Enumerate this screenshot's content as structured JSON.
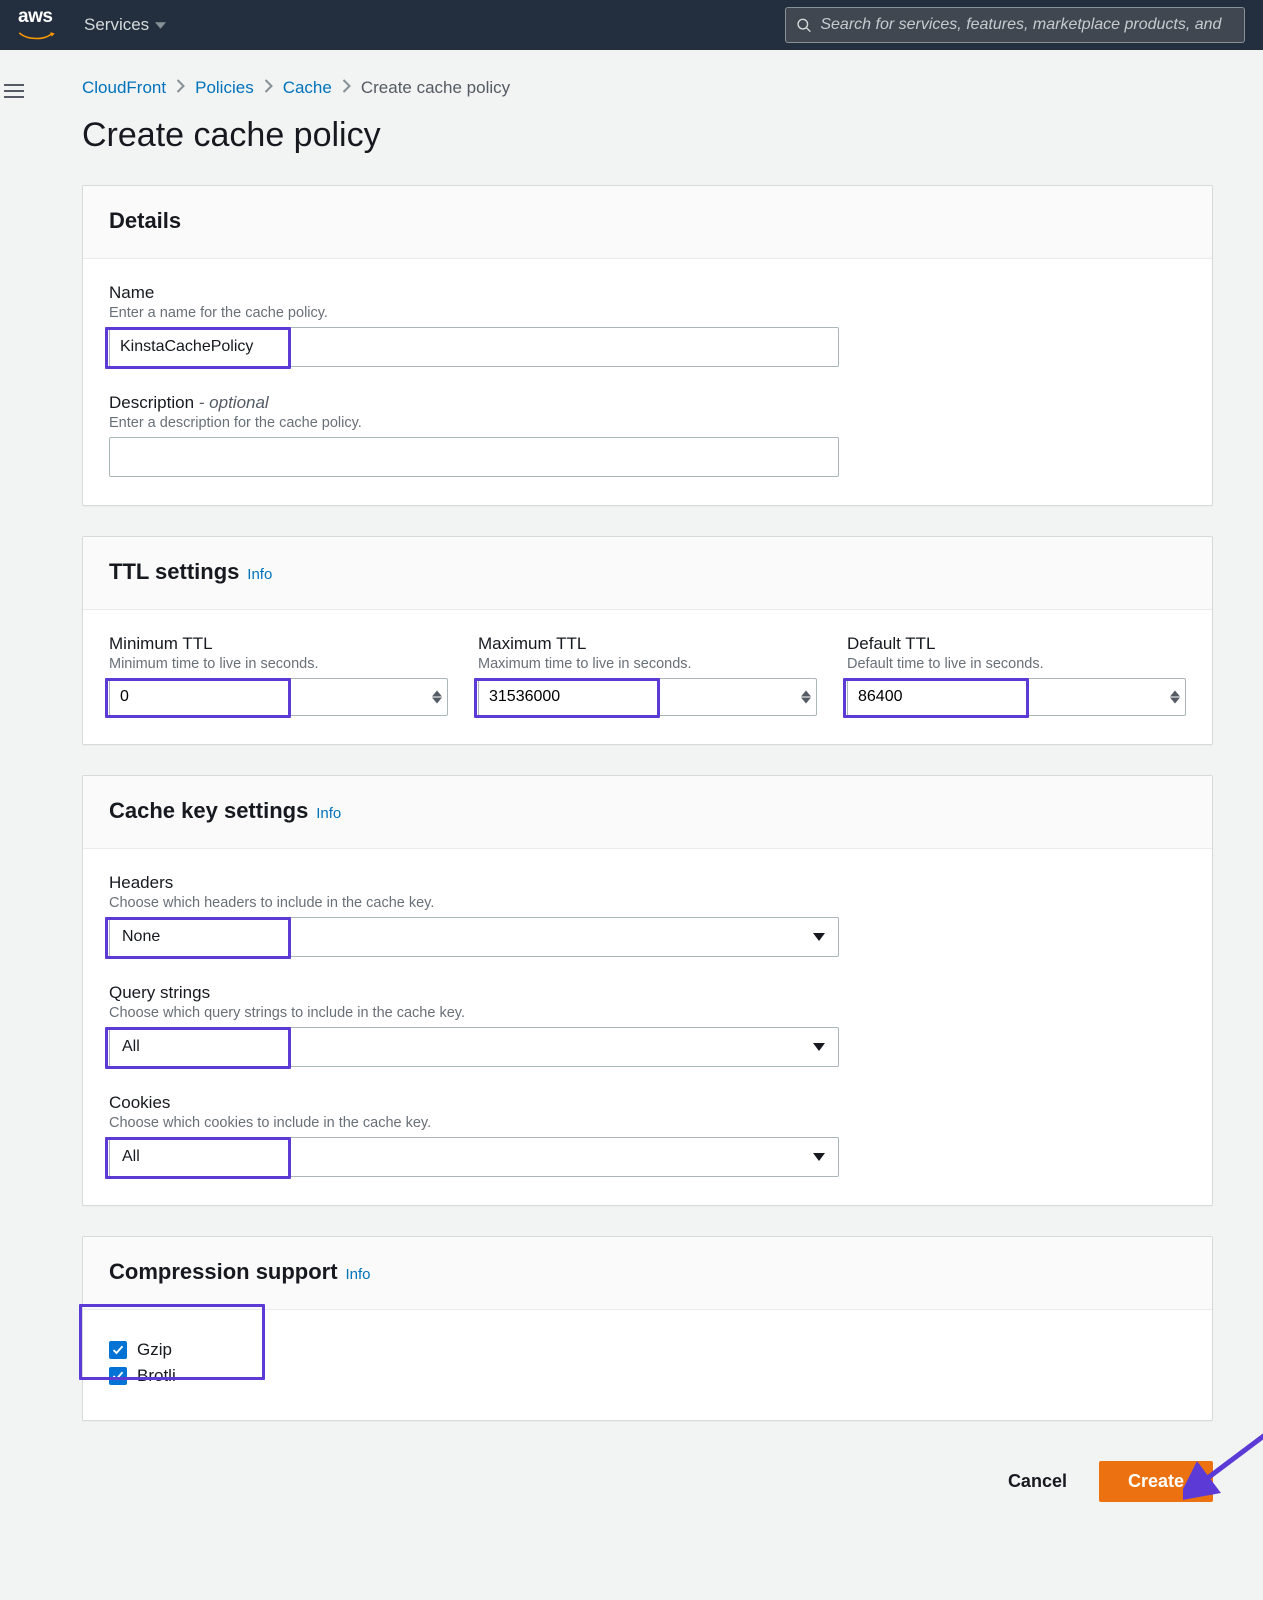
{
  "nav": {
    "brand": "aws",
    "services_label": "Services",
    "search_placeholder": "Search for services, features, marketplace products, and"
  },
  "breadcrumb": {
    "items": [
      "CloudFront",
      "Policies",
      "Cache",
      "Create cache policy"
    ]
  },
  "page": {
    "title": "Create cache policy"
  },
  "details": {
    "heading": "Details",
    "name_label": "Name",
    "name_hint": "Enter a name for the cache policy.",
    "name_value": "KinstaCachePolicy",
    "desc_label": "Description",
    "desc_optional": " - optional",
    "desc_hint": "Enter a description for the cache policy.",
    "desc_value": ""
  },
  "ttl": {
    "heading": "TTL settings",
    "info": "Info",
    "min_label": "Minimum TTL",
    "min_hint": "Minimum time to live in seconds.",
    "min_value": "0",
    "max_label": "Maximum TTL",
    "max_hint": "Maximum time to live in seconds.",
    "max_value": "31536000",
    "def_label": "Default TTL",
    "def_hint": "Default time to live in seconds.",
    "def_value": "86400"
  },
  "cachekey": {
    "heading": "Cache key settings",
    "info": "Info",
    "headers_label": "Headers",
    "headers_hint": "Choose which headers to include in the cache key.",
    "headers_value": "None",
    "qs_label": "Query strings",
    "qs_hint": "Choose which query strings to include in the cache key.",
    "qs_value": "All",
    "cookies_label": "Cookies",
    "cookies_hint": "Choose which cookies to include in the cache key.",
    "cookies_value": "All"
  },
  "compression": {
    "heading": "Compression support",
    "info": "Info",
    "gzip_label": "Gzip",
    "gzip_checked": true,
    "brotli_label": "Brotli",
    "brotli_checked": true
  },
  "footer": {
    "cancel": "Cancel",
    "create": "Create"
  }
}
